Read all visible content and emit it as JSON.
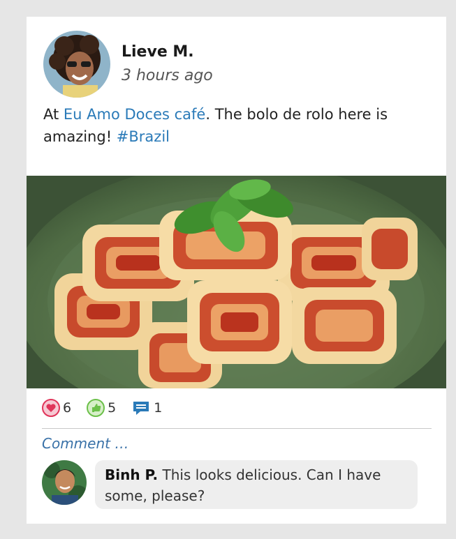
{
  "post": {
    "author": "Lieve M.",
    "time": "3 hours ago",
    "text_prefix": "At ",
    "place_link": "Eu Amo Doces café",
    "text_middle": ". The bolo de rolo here is amazing! ",
    "hashtag": "#Brazil"
  },
  "reactions": {
    "love_count": "6",
    "like_count": "5",
    "comment_count": "1",
    "colors": {
      "love": "#e0355a",
      "like": "#6cc04a",
      "comment": "#2a7ab8"
    }
  },
  "comment_input": {
    "placeholder": "Comment …"
  },
  "comments": [
    {
      "author": "Binh P.",
      "text": " This looks delicious. Can I have some, please?"
    }
  ]
}
